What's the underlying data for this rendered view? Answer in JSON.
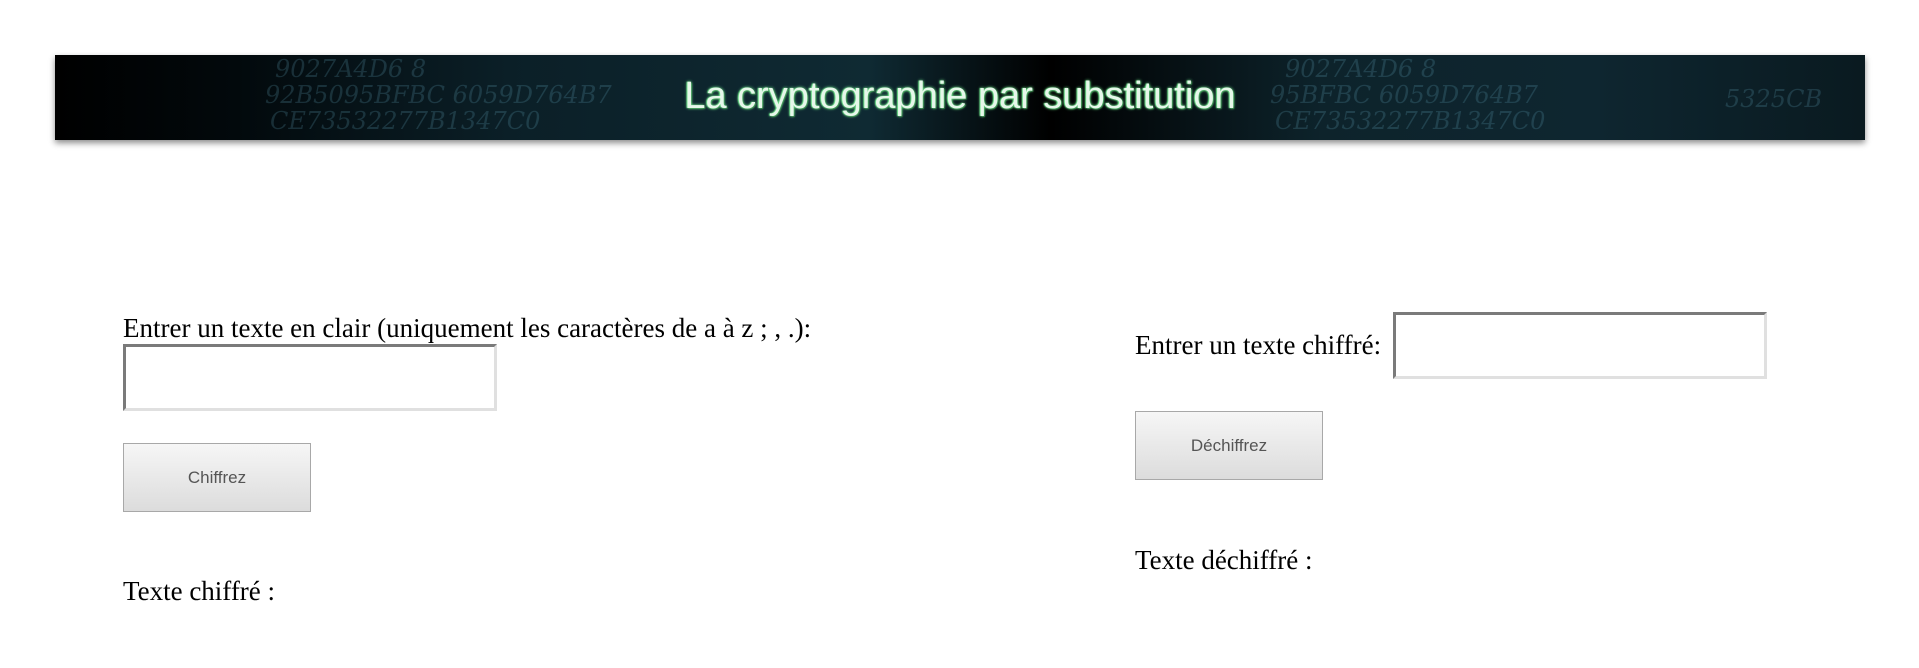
{
  "header": {
    "title": "La cryptographie par substitution",
    "texture_lines": [
      "9027A4D6  8",
      "92B5095BFBC  6059D764B7",
      "CE73532277B1347C0",
      "9027A4D6  8",
      "95BFBC  6059D764B7",
      "CE73532277B1347C0",
      "5325CB"
    ]
  },
  "encrypt": {
    "prompt_label": "Entrer un texte en clair (uniquement les caractères de a à z ; , .):",
    "input_value": "",
    "button_label": "Chiffrez",
    "result_label": "Texte chiffré :"
  },
  "decrypt": {
    "prompt_label": "Entrer un texte chiffré:",
    "input_value": "",
    "button_label": "Déchiffrez",
    "result_label": "Texte déchiffré :"
  },
  "colors": {
    "banner_bg": "#000000",
    "title_text": "#e6f7ea",
    "title_glow": "#7dff9a",
    "button_text": "#555555"
  }
}
